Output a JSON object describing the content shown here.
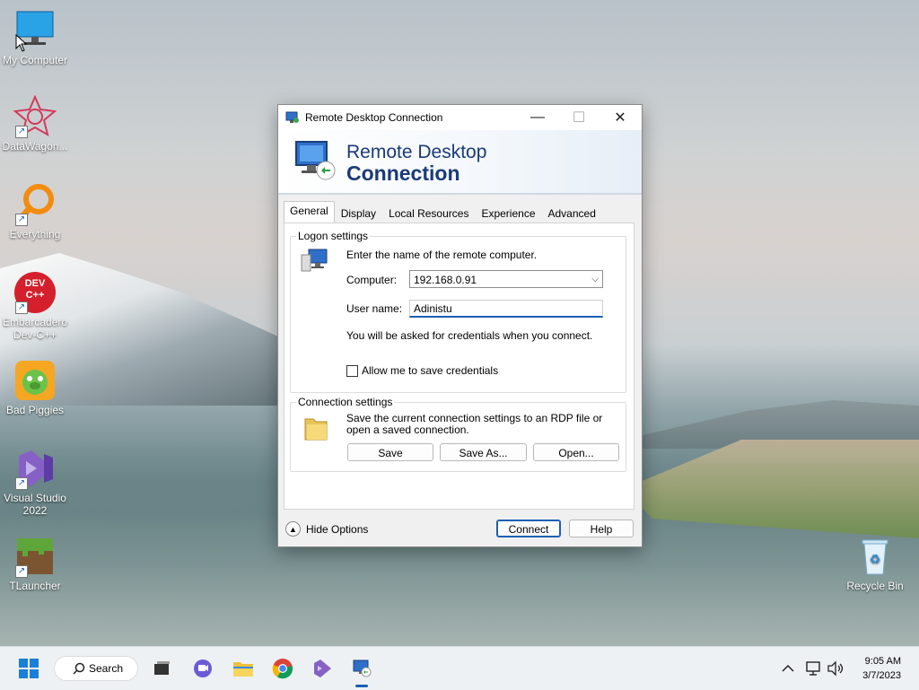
{
  "desktop": {
    "icons": [
      {
        "label": "My Computer"
      },
      {
        "label": "DataWagon..."
      },
      {
        "label": "Everything"
      },
      {
        "label": "Embarcadero Dev-C++",
        "badge": "DEV C++"
      },
      {
        "label": "Bad Piggies"
      },
      {
        "label": "Visual Studio 2022"
      },
      {
        "label": "TLauncher"
      },
      {
        "label": "Recycle Bin"
      }
    ]
  },
  "window": {
    "title": "Remote Desktop Connection",
    "controls": {
      "minimize": "—",
      "maximize": "☐",
      "close": "✕"
    },
    "banner": {
      "line1": "Remote Desktop",
      "line2": "Connection"
    },
    "tabs": [
      {
        "label": "General",
        "active": true
      },
      {
        "label": "Display"
      },
      {
        "label": "Local Resources"
      },
      {
        "label": "Experience"
      },
      {
        "label": "Advanced"
      }
    ],
    "logon": {
      "group_label": "Logon settings",
      "instruction": "Enter the name of the remote computer.",
      "computer_label": "Computer:",
      "computer_value": "192.168.0.91",
      "username_label": "User name:",
      "username_value": "Adinistu",
      "credentials_note": "You will be asked for credentials when you connect.",
      "save_credentials_label": "Allow me to save credentials"
    },
    "connection": {
      "group_label": "Connection settings",
      "description": "Save the current connection settings to an RDP file or open a saved connection.",
      "save_label": "Save",
      "save_as_label": "Save As...",
      "open_label": "Open..."
    },
    "footer": {
      "hide_options_label": "Hide Options",
      "connect_label": "Connect",
      "help_label": "Help"
    }
  },
  "taskbar": {
    "search_label": "Search",
    "time": "9:05 AM",
    "date": "3/7/2023"
  },
  "colors": {
    "accent": "#1a5fb4",
    "banner_text": "#1a3a78"
  }
}
